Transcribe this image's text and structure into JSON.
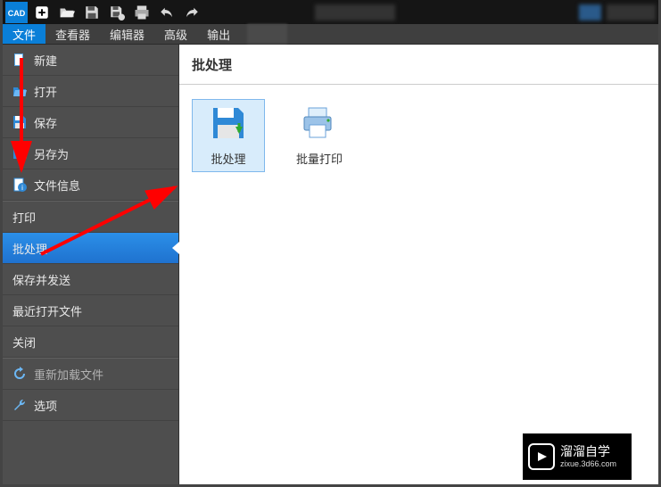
{
  "logo_text": "CAD",
  "menu": {
    "tabs": [
      "文件",
      "查看器",
      "编辑器",
      "高级",
      "输出"
    ],
    "active_index": 0
  },
  "sidebar": {
    "items": [
      {
        "label": "新建",
        "icon": "file-icon"
      },
      {
        "label": "打开",
        "icon": "folder-open-icon"
      },
      {
        "label": "保存",
        "icon": "save-icon"
      },
      {
        "label": "另存为",
        "icon": "save-as-icon"
      },
      {
        "label": "文件信息",
        "icon": "file-info-icon"
      },
      {
        "label": "打印",
        "icon": null
      },
      {
        "label": "批处理",
        "icon": null,
        "selected": true
      },
      {
        "label": "保存并发送",
        "icon": null
      },
      {
        "label": "最近打开文件",
        "icon": null
      },
      {
        "label": "关闭",
        "icon": null
      },
      {
        "label": "重新加载文件",
        "icon": "reload-icon",
        "muted": true
      },
      {
        "label": "选项",
        "icon": "wrench-icon"
      }
    ]
  },
  "main": {
    "title": "批处理",
    "options": [
      {
        "label": "批处理",
        "icon": "batch-save-icon",
        "selected": true
      },
      {
        "label": "批量打印",
        "icon": "batch-print-icon"
      }
    ]
  },
  "watermark": {
    "line1": "溜溜自学",
    "line2": "zixue.3d66.com"
  }
}
